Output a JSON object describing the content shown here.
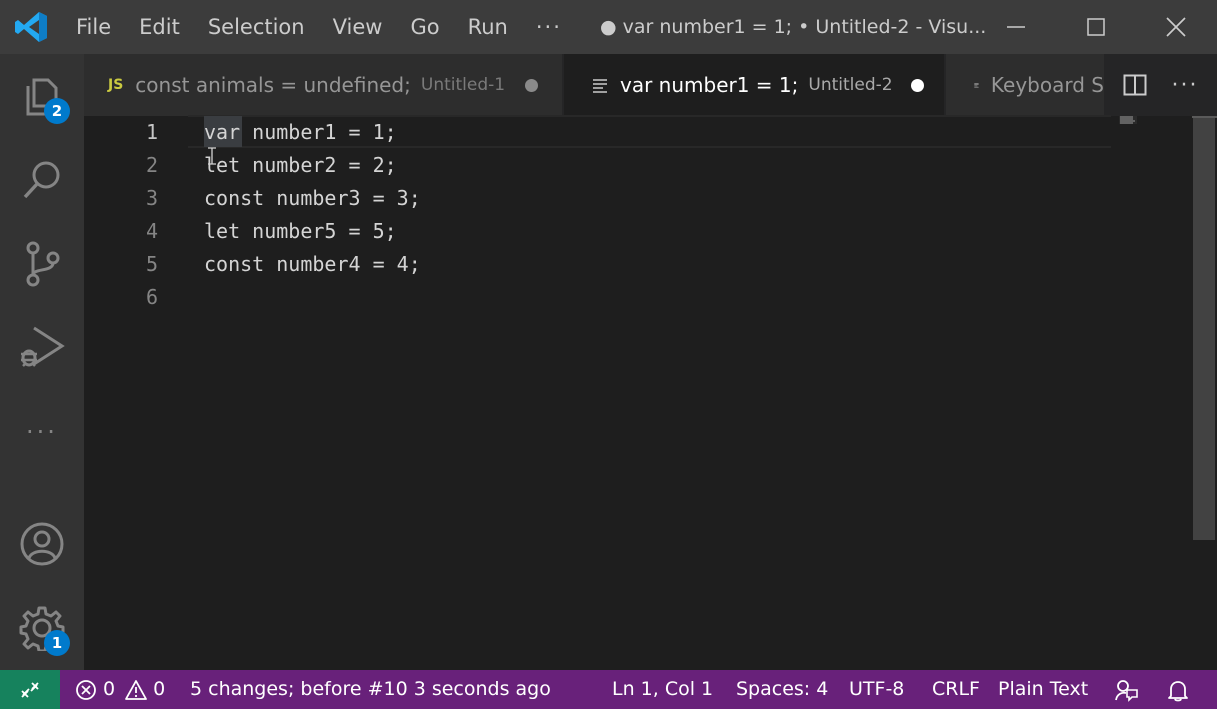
{
  "titlebar": {
    "menu": [
      "File",
      "Edit",
      "Selection",
      "View",
      "Go",
      "Run"
    ],
    "more": "···",
    "window_title": "● var number1 = 1; • Untitled-2 - Visu..."
  },
  "activity_bar": {
    "explorer_badge": "2",
    "settings_badge": "1",
    "more": "···"
  },
  "tabs": [
    {
      "icon": "JS",
      "title": "const animals = undefined;",
      "subtitle": "Untitled-1",
      "dirty": true,
      "active": false
    },
    {
      "title": "var number1 = 1;",
      "subtitle": "Untitled-2",
      "dirty": true,
      "active": true
    },
    {
      "title": "Keyboard S",
      "subtitle": "",
      "dirty": false,
      "active": false
    }
  ],
  "tab_actions": {
    "more": "···"
  },
  "editor": {
    "line_numbers": [
      "1",
      "2",
      "3",
      "4",
      "5",
      "6"
    ],
    "lines": [
      "var number1 = 1;",
      "let number2 = 2;",
      "const number3 = 3;",
      "let number5 = 5;",
      "const number4 = 4;",
      ""
    ],
    "active_line": 1
  },
  "statusbar": {
    "errors": "0",
    "warnings": "0",
    "timeline": "5 changes; before #10  3 seconds ago",
    "position": "Ln 1, Col 1",
    "spaces": "Spaces: 4",
    "encoding": "UTF-8",
    "eol": "CRLF",
    "language": "Plain Text"
  },
  "colors": {
    "statusbar": "#68217a",
    "remote": "#16825d",
    "badge": "#007acc",
    "activitybar": "#333333",
    "titlebar": "#3c3c3c",
    "editor": "#1e1e1e"
  }
}
